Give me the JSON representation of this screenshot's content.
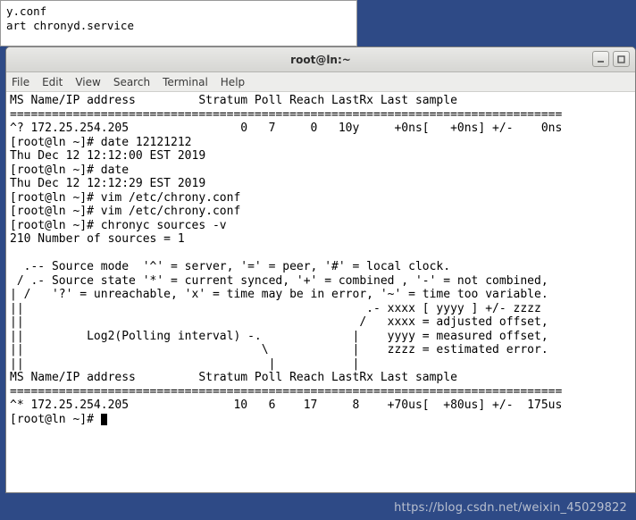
{
  "bg_window": {
    "line1": "y.conf",
    "line2": "art chronyd.service"
  },
  "titlebar": {
    "title": "root@ln:~"
  },
  "menubar": {
    "items": [
      "File",
      "Edit",
      "View",
      "Search",
      "Terminal",
      "Help"
    ]
  },
  "terminal": {
    "lines": [
      "MS Name/IP address         Stratum Poll Reach LastRx Last sample",
      "===============================================================================",
      "^? 172.25.254.205                0   7     0   10y     +0ns[   +0ns] +/-    0ns",
      "[root@ln ~]# date 12121212",
      "Thu Dec 12 12:12:00 EST 2019",
      "[root@ln ~]# date",
      "Thu Dec 12 12:12:29 EST 2019",
      "[root@ln ~]# vim /etc/chrony.conf",
      "[root@ln ~]# vim /etc/chrony.conf",
      "[root@ln ~]# chronyc sources -v",
      "210 Number of sources = 1",
      "",
      "  .-- Source mode  '^' = server, '=' = peer, '#' = local clock.",
      " / .- Source state '*' = current synced, '+' = combined , '-' = not combined,",
      "| /   '?' = unreachable, 'x' = time may be in error, '~' = time too variable.",
      "||                                                 .- xxxx [ yyyy ] +/- zzzz",
      "||                                                /   xxxx = adjusted offset,",
      "||         Log2(Polling interval) -.             |    yyyy = measured offset,",
      "||                                  \\            |    zzzz = estimated error.",
      "||                                   |           |",
      "MS Name/IP address         Stratum Poll Reach LastRx Last sample",
      "===============================================================================",
      "^* 172.25.254.205               10   6    17     8    +70us[  +80us] +/-  175us",
      "[root@ln ~]# "
    ]
  },
  "watermark": "https://blog.csdn.net/weixin_45029822"
}
